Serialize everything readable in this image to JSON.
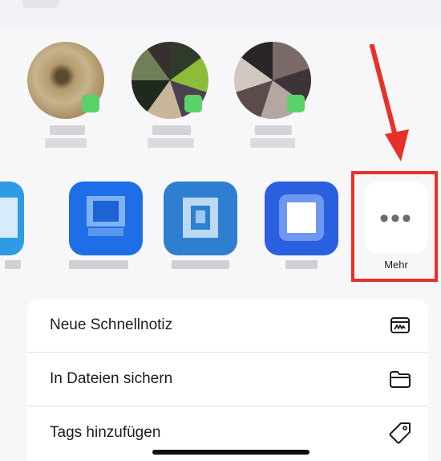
{
  "share_sheet": {
    "more_label": "Mehr"
  },
  "actions": [
    {
      "label": "Neue Schnellnotiz",
      "icon": "quick-note-icon"
    },
    {
      "label": "In Dateien sichern",
      "icon": "folder-icon"
    },
    {
      "label": "Tags hinzufügen",
      "icon": "tag-icon"
    }
  ],
  "colors": {
    "highlight": "#e8302a",
    "arrow": "#e8302a",
    "sheet_background": "#f7f7f9",
    "menu_background": "#ffffff"
  }
}
